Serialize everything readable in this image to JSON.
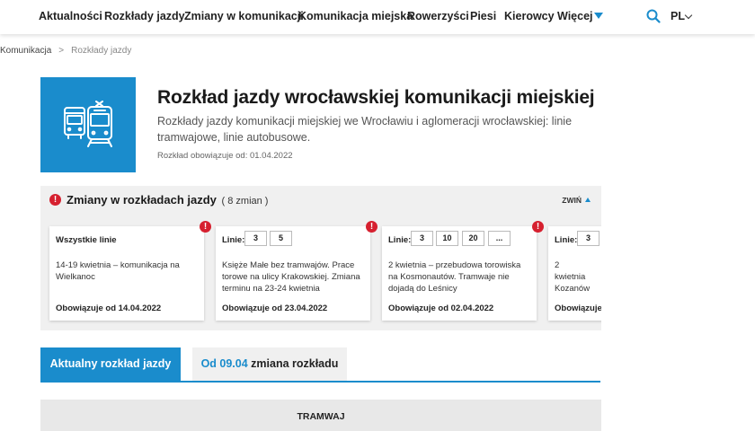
{
  "nav": {
    "items": [
      "Aktualności",
      "Rozkłady jazdy",
      "Zmiany w komunikacji",
      "Komunikacja miejska",
      "Rowerzyści",
      "Piesi",
      "Kierowcy",
      "Więcej"
    ],
    "lang": "PL",
    "accent": "#1a8ccc"
  },
  "breadcrumb": {
    "parent": "Komunikacja",
    "separator": ">",
    "current": "Rozkłady jazdy"
  },
  "header": {
    "icon": "tram-bus-icon",
    "title": "Rozkład jazdy wrocławskiej komunikacji miejskiej",
    "description": "Rozkłady jazdy komunikacji miejskiej we Wrocławiu i aglomeracji wrocławskiej: linie tramwajowe, linie autobusowe.",
    "valid_from": "Rozkład obowiązuje od: 01.04.2022"
  },
  "changes": {
    "title": "Zmiany w rozkładach jazdy",
    "count": "( 8 zmian )",
    "collapse_label": "ZWIŃ",
    "alert_color": "#d6202f",
    "cards": [
      {
        "all_lines": "Wszystkie linie",
        "lines_label": "",
        "lines": [],
        "description": "14-19 kwietnia – komunikacja na Wielkanoc",
        "valid": "Obowiązuje od 14.04.2022"
      },
      {
        "all_lines": "",
        "lines_label": "Linie:",
        "lines": [
          "3",
          "5"
        ],
        "description": "Księże Małe bez tramwajów. Prace torowe na ulicy Krakowskiej. Zmiana terminu na 23-24 kwietnia",
        "valid": "Obowiązuje od 23.04.2022"
      },
      {
        "all_lines": "",
        "lines_label": "Linie:",
        "lines": [
          "3",
          "10",
          "20",
          "..."
        ],
        "description": "2 kwietnia – przebudowa torowiska na Kosmonautów. Tramwaje nie dojadą do Leśnicy",
        "valid": "Obowiązuje od 02.04.2022"
      },
      {
        "all_lines": "",
        "lines_label": "Linie:",
        "lines": [
          "3"
        ],
        "description": "2 kwietnia Kozanów",
        "valid": "Obowiązuje"
      }
    ]
  },
  "tabs": {
    "active": "Aktualny rozkład jazdy",
    "inactive_date": "Od 09.04",
    "inactive_rest": " zmiana rozkładu"
  },
  "section": {
    "label": "TRAMWAJ"
  }
}
